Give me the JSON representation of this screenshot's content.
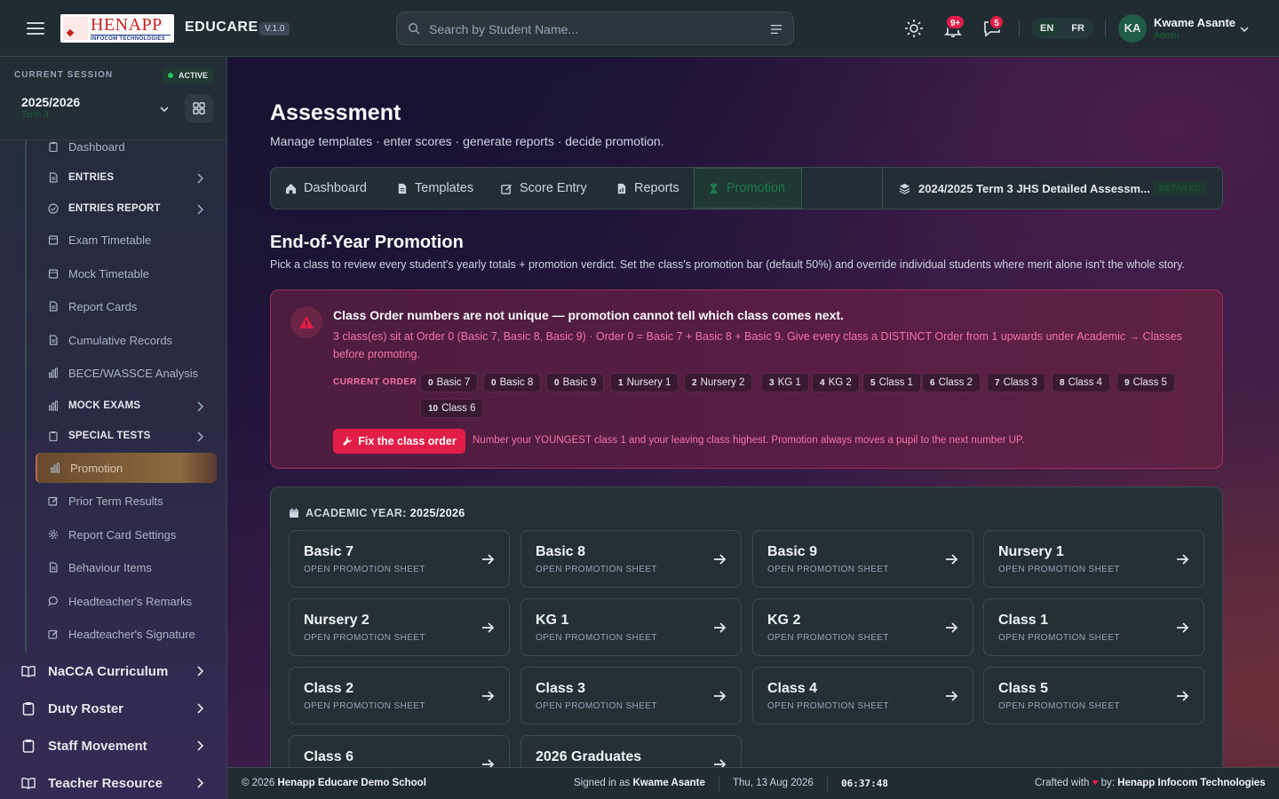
{
  "header": {
    "logo_text": "HENAPP",
    "logo_sub": "INFOCOM TECHNOLOGIES",
    "app_name": "EDUCARE",
    "version": "V.1.0",
    "search_placeholder": "Search by Student Name...",
    "notifications_badge": "9+",
    "messages_badge": "5",
    "languages": [
      "EN",
      "FR"
    ],
    "active_language": "EN",
    "user_initials": "KA",
    "user_name": "Kwame Asante",
    "user_role": "Admin"
  },
  "session": {
    "label": "CURRENT SESSION",
    "status": "ACTIVE",
    "year": "2025/2026",
    "term": "Term 3"
  },
  "sidebar": {
    "sub_items": [
      {
        "label": "Dashboard",
        "bold": false,
        "icon": "clipboard-icon",
        "chevron": false
      },
      {
        "label": "ENTRIES",
        "bold": true,
        "icon": "document-icon",
        "chevron": true
      },
      {
        "label": "ENTRIES REPORT",
        "bold": true,
        "icon": "check-circle-icon",
        "chevron": true
      },
      {
        "label": "Exam Timetable",
        "bold": false,
        "icon": "calendar-icon",
        "chevron": false
      },
      {
        "label": "Mock Timetable",
        "bold": false,
        "icon": "calendar-icon",
        "chevron": false
      },
      {
        "label": "Report Cards",
        "bold": false,
        "icon": "document-icon",
        "chevron": false
      },
      {
        "label": "Cumulative Records",
        "bold": false,
        "icon": "document-icon",
        "chevron": false
      },
      {
        "label": "BECE/WASSCE Analysis",
        "bold": false,
        "icon": "bar-chart-icon",
        "chevron": false
      },
      {
        "label": "MOCK EXAMS",
        "bold": true,
        "icon": "bar-chart-icon",
        "chevron": true
      },
      {
        "label": "SPECIAL TESTS",
        "bold": true,
        "icon": "clipboard-icon",
        "chevron": true
      },
      {
        "label": "Promotion",
        "bold": false,
        "icon": "bar-chart-icon",
        "chevron": false,
        "selected": true
      },
      {
        "label": "Prior Term Results",
        "bold": false,
        "icon": "edit-icon",
        "chevron": false
      },
      {
        "label": "Report Card Settings",
        "bold": false,
        "icon": "gear-icon",
        "chevron": false
      },
      {
        "label": "Behaviour Items",
        "bold": false,
        "icon": "document-icon",
        "chevron": false
      },
      {
        "label": "Headteacher's Remarks",
        "bold": false,
        "icon": "chat-icon",
        "chevron": false
      },
      {
        "label": "Headteacher's Signature",
        "bold": false,
        "icon": "edit-icon",
        "chevron": false
      }
    ],
    "sections": [
      {
        "label": "NaCCA Curriculum",
        "icon": "book-icon"
      },
      {
        "label": "Duty Roster",
        "icon": "clipboard-icon"
      },
      {
        "label": "Staff Movement",
        "icon": "clipboard-icon"
      },
      {
        "label": "Teacher Resource",
        "icon": "book-icon"
      }
    ]
  },
  "page": {
    "title": "Assessment",
    "subtitle": "Manage templates · enter scores · generate reports · decide promotion.",
    "tabs": [
      {
        "label": "Dashboard",
        "icon": "home-icon"
      },
      {
        "label": "Templates",
        "icon": "document-icon"
      },
      {
        "label": "Score Entry",
        "icon": "edit-icon"
      },
      {
        "label": "Reports",
        "icon": "report-icon"
      },
      {
        "label": "Promotion",
        "icon": "hourglass-icon",
        "active": true
      }
    ],
    "template_selector": "2024/2025 Term 3 JHS Detailed Assessm...",
    "template_badge": "DETAILED"
  },
  "promotion": {
    "title": "End-of-Year Promotion",
    "description": "Pick a class to review every student's yearly totals + promotion verdict. Set the class's promotion bar (default 50%) and override individual students where merit alone isn't the whole story."
  },
  "alert": {
    "title": "Class Order numbers are not unique — promotion cannot tell which class comes next.",
    "message": "3 class(es) sit at Order 0 (Basic 7, Basic 8, Basic 9) · Order 0 = Basic 7 + Basic 8 + Basic 9. Give every class a DISTINCT Order from 1 upwards under Academic → Classes before promoting.",
    "current_order_label": "CURRENT ORDER",
    "order_chips": [
      {
        "order": "0",
        "name": "Basic 7"
      },
      {
        "order": "0",
        "name": "Basic 8"
      },
      {
        "order": "0",
        "name": "Basic 9"
      },
      {
        "order": "1",
        "name": "Nursery 1"
      },
      {
        "order": "2",
        "name": "Nursery 2"
      },
      {
        "order": "3",
        "name": "KG 1"
      },
      {
        "order": "4",
        "name": "KG 2"
      },
      {
        "order": "5",
        "name": "Class 1"
      },
      {
        "order": "6",
        "name": "Class 2"
      },
      {
        "order": "7",
        "name": "Class 3"
      },
      {
        "order": "8",
        "name": "Class 4"
      },
      {
        "order": "9",
        "name": "Class 5"
      },
      {
        "order": "10",
        "name": "Class 6"
      }
    ],
    "fix_button": "Fix the class order",
    "fix_note": "Number your YOUNGEST class 1 and your leaving class highest. Promotion always moves a pupil to the next number UP."
  },
  "classes": {
    "year_label": "ACADEMIC YEAR:",
    "year_value": "2025/2026",
    "card_subtitle": "OPEN PROMOTION SHEET",
    "cards": [
      "Basic 7",
      "Basic 8",
      "Basic 9",
      "Nursery 1",
      "Nursery 2",
      "KG 1",
      "KG 2",
      "Class 1",
      "Class 2",
      "Class 3",
      "Class 4",
      "Class 5",
      "Class 6",
      "2026 Graduates"
    ]
  },
  "footer": {
    "copyright": "© 2026",
    "school": "Henapp Educare Demo School",
    "signed_in_prefix": "Signed in as",
    "signed_in_user": "Kwame Asante",
    "date": "Thu, 13 Aug 2026",
    "time": "06:37:48",
    "crafted_prefix": "Crafted with",
    "crafted_by": "by:",
    "company": "Henapp Infocom Technologies"
  },
  "colors": {
    "accent_green": "#1f7a4c",
    "alert_red": "#e11d48",
    "alert_text": "#f472a6"
  }
}
